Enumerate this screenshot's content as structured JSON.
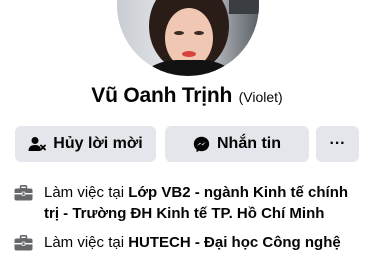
{
  "profile": {
    "name": "Vũ Oanh Trịnh",
    "alternate_name": "(Violet)"
  },
  "actions": {
    "cancel_request_label": "Hủy lời mời",
    "message_label": "Nhắn tin",
    "more_label": "···"
  },
  "work": [
    {
      "prefix": "Làm việc tại",
      "place": "Lớp VB2 - ngành Kinh tế chính trị - Trường ĐH Kinh tế TP. Hồ Chí Minh"
    },
    {
      "prefix": "Làm việc tại",
      "place": "HUTECH - Đại học Công nghệ"
    }
  ],
  "icons": {
    "cancel_request": "user-cancel-icon",
    "message": "messenger-icon",
    "work": "briefcase-icon"
  },
  "colors": {
    "button_bg": "#e4e6eb",
    "text": "#050505",
    "icon_gray": "#65676b"
  }
}
